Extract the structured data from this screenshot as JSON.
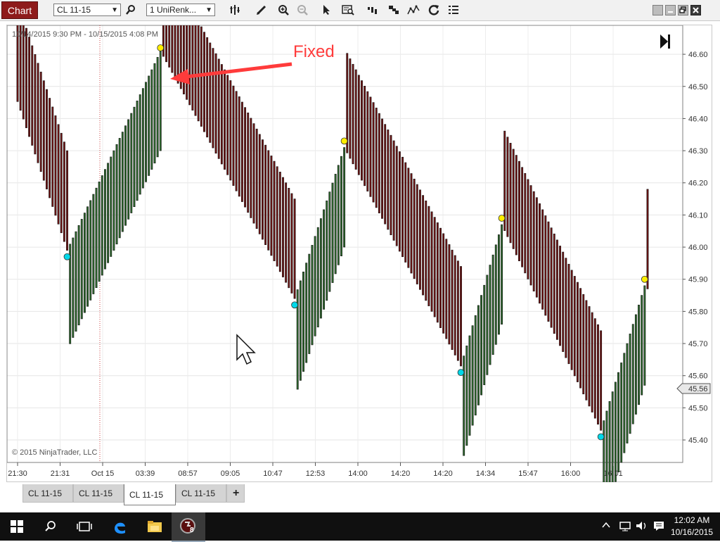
{
  "toolbar": {
    "chart_label": "Chart",
    "instrument": "CL 11-15",
    "bar_type": "1 UniRenk...",
    "icons": [
      "search-icon",
      "bar-style-icon",
      "pencil-icon",
      "zoom-in-icon",
      "zoom-out-icon",
      "pointer-icon",
      "data-box-icon",
      "strategies-icon",
      "order-icon",
      "indicators-icon",
      "refresh-icon",
      "properties-icon"
    ]
  },
  "chart": {
    "date_range": "10/14/2015 9:30 PM - 10/15/2015 4:08 PM",
    "copyright": "© 2015 NinjaTrader, LLC",
    "annotation": "Fixed",
    "current_price_label": "45.56",
    "colors": {
      "up": "#2e6a2e",
      "down": "#701414",
      "high_swing": "#ffee00",
      "low_swing": "#00d8e8",
      "arrow": "#ff3b3b"
    }
  },
  "chart_data": {
    "type": "bar",
    "ylim": [
      45.33,
      46.69
    ],
    "y_ticks": [
      "46.60",
      "46.50",
      "46.40",
      "46.30",
      "46.20",
      "46.10",
      "46.00",
      "45.90",
      "45.80",
      "45.70",
      "45.60",
      "45.50",
      "45.40"
    ],
    "x_ticks": [
      "21:30",
      "21:31",
      "Oct 15",
      "03:39",
      "08:57",
      "09:05",
      "10:47",
      "12:53",
      "14:00",
      "14:20",
      "14:20",
      "14:34",
      "15:47",
      "16:00",
      "16:01"
    ],
    "bar_height": 0.31,
    "legs": [
      {
        "direction": "down",
        "from": 46.48,
        "to": 45.99,
        "bars": 18
      },
      {
        "direction": "up",
        "from": 45.99,
        "to": 46.61,
        "bars": 32
      },
      {
        "direction": "down",
        "from": 46.61,
        "to": 45.84,
        "bars": 46
      },
      {
        "direction": "up",
        "from": 45.84,
        "to": 46.31,
        "bars": 17
      },
      {
        "direction": "down",
        "from": 46.31,
        "to": 45.63,
        "bars": 40
      },
      {
        "direction": "up",
        "from": 45.63,
        "to": 46.07,
        "bars": 14
      },
      {
        "direction": "down",
        "from": 46.07,
        "to": 45.43,
        "bars": 34
      },
      {
        "direction": "up",
        "from": 45.43,
        "to": 45.88,
        "bars": 15
      },
      {
        "direction": "down",
        "from": 45.88,
        "to": 45.87,
        "bars": 1
      }
    ],
    "swing_highs": [
      46.62,
      46.33,
      46.09,
      45.9
    ],
    "swing_lows": [
      45.97,
      45.82,
      45.61,
      45.41
    ]
  },
  "tabs": [
    "CL 11-15",
    "CL 11-15",
    "CL 11-15",
    "CL 11-15"
  ],
  "active_tab": 2,
  "add_tab_label": "+",
  "taskbar": {
    "time": "12:02 AM",
    "date": "10/16/2015",
    "ninja_badge": "8"
  }
}
